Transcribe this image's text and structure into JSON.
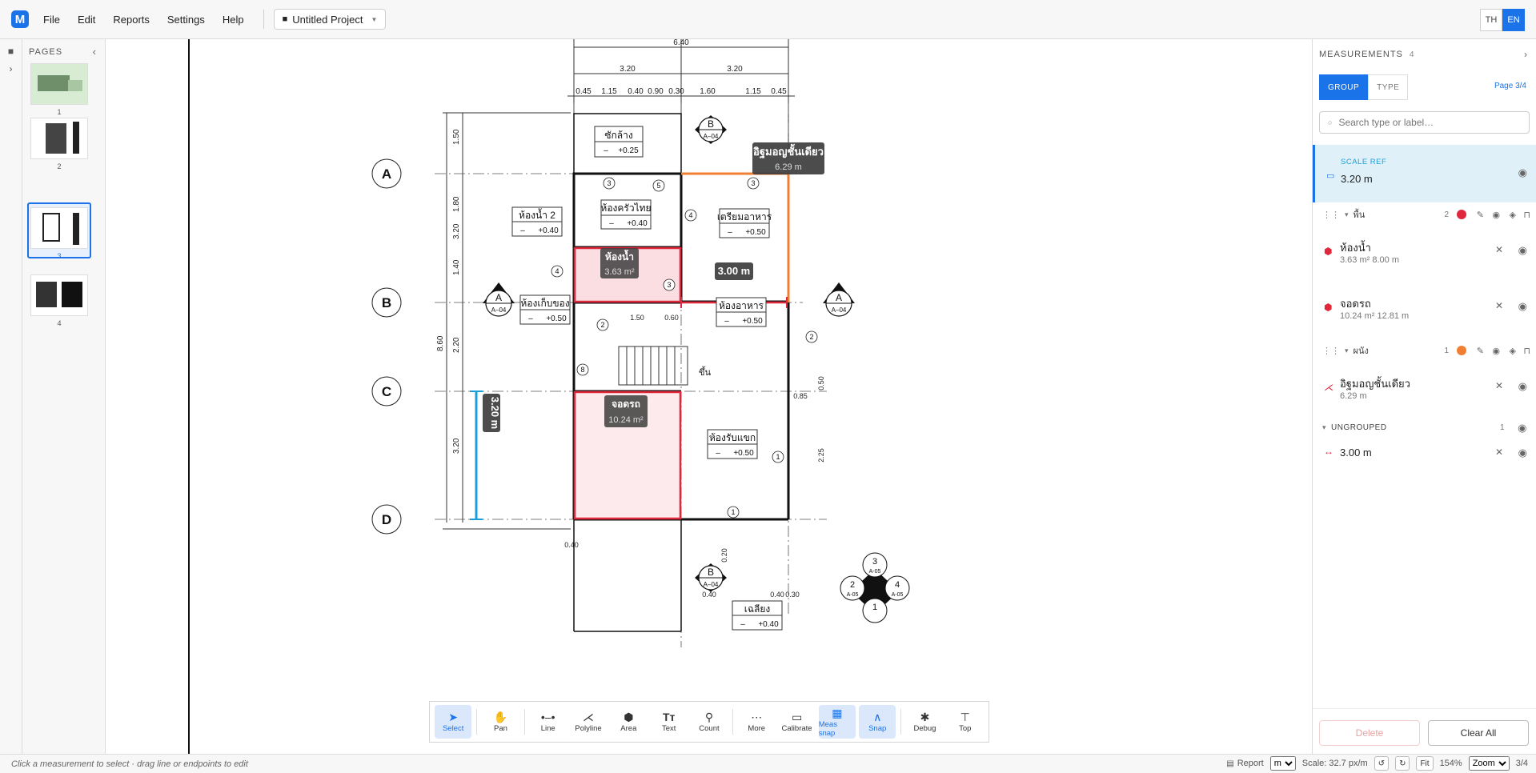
{
  "menu": {
    "file": "File",
    "edit": "Edit",
    "reports": "Reports",
    "settings": "Settings",
    "help": "Help"
  },
  "project": {
    "name": "Untitled Project"
  },
  "lang": {
    "th": "TH",
    "en": "EN"
  },
  "pages": {
    "title": "PAGES",
    "items": [
      {
        "num": "1"
      },
      {
        "num": "2"
      },
      {
        "num": "3"
      },
      {
        "num": "4"
      }
    ]
  },
  "plan": {
    "grid": [
      "A",
      "B",
      "C",
      "D"
    ],
    "dims_top": [
      "6.40",
      "3.20",
      "3.20",
      "0.45",
      "1.15",
      "0.40",
      "0.90",
      "0.30",
      "1.60",
      "1.15",
      "0.45"
    ],
    "dims_left": [
      "1.50",
      "1.80",
      "3.20",
      "1.40",
      "8.60",
      "2.20",
      "3.20"
    ],
    "rooms": [
      {
        "name": "ซักล้าง",
        "level": "+0.25"
      },
      {
        "name": "ห้องครัวไทย",
        "level": "+0.40"
      },
      {
        "name": "ห้องน้ำ 2",
        "level": "+0.40"
      },
      {
        "name": "เตรียมอาหาร",
        "level": "+0.50"
      },
      {
        "name": "ห้องเก็บของ",
        "level": "+0.50"
      },
      {
        "name": "ห้องอาหาร",
        "level": "+0.50"
      },
      {
        "name": "ห้องรับแขก",
        "level": "+0.50"
      },
      {
        "name": "เฉลียง",
        "level": "+0.40"
      }
    ],
    "dash": "–",
    "stairs_label": "ขึ้น",
    "labels": {
      "perimeter": {
        "name": "อิฐมอญชั้นเดียว",
        "value": "6.29 m"
      },
      "bath": {
        "name": "ห้องน้ำ",
        "value": "3.63 m²"
      },
      "garage": {
        "name": "จอดรถ",
        "value": "10.24 m²"
      },
      "line": "3.00 m",
      "scale": "3.20 m"
    },
    "section_marks": [
      {
        "letter": "B",
        "ref": "A–04"
      },
      {
        "letter": "A",
        "ref": "A–04"
      },
      {
        "letter": "A",
        "ref": "A–04"
      },
      {
        "letter": "B",
        "ref": "A–04"
      }
    ],
    "elev_marks": [
      {
        "num": "3",
        "ref": "A-05"
      },
      {
        "num": "2",
        "ref": "A-05"
      },
      {
        "num": "4",
        "ref": "A-05"
      },
      {
        "num": "1",
        "ref": ""
      }
    ],
    "small_dims": [
      "1.50",
      "0.60",
      "0.85",
      "0.50",
      "2.25",
      "0.40",
      "0.20",
      "0.40",
      "0.30",
      "0.40"
    ],
    "circles": [
      "3",
      "5",
      "3",
      "4",
      "4",
      "3",
      "2",
      "8",
      "2",
      "1",
      "1"
    ]
  },
  "toolbar": {
    "tools": [
      {
        "label": "Select"
      },
      {
        "label": "Pan"
      },
      {
        "label": "Line"
      },
      {
        "label": "Polyline"
      },
      {
        "label": "Area"
      },
      {
        "label": "Text"
      },
      {
        "label": "Count"
      },
      {
        "label": "More"
      },
      {
        "label": "Calibrate"
      },
      {
        "label": "Meas snap"
      },
      {
        "label": "Snap"
      },
      {
        "label": "Debug"
      },
      {
        "label": "Top"
      }
    ],
    "text_glyph": "Tт"
  },
  "measurements": {
    "title": "MEASUREMENTS",
    "count": "4",
    "tabs": {
      "group": "GROUP",
      "type": "TYPE"
    },
    "page_badge": "Page 3/4",
    "search_placeholder": "Search type or label…",
    "scale_ref": {
      "label": "SCALE REF",
      "value": "3.20 m"
    },
    "groups": [
      {
        "name": "พื้น",
        "count": "2",
        "color": "#e0283c"
      },
      {
        "name": "ผนัง",
        "count": "1",
        "color": "#f07f34"
      }
    ],
    "items": [
      {
        "name": "ห้องน้ำ",
        "sub": "3.63 m² 8.00 m"
      },
      {
        "name": "จอดรถ",
        "sub": "10.24 m² 12.81 m"
      },
      {
        "name": "อิฐมอญชั้นเดียว",
        "sub": "6.29 m"
      }
    ],
    "ungrouped": {
      "label": "UNGROUPED",
      "count": "1"
    },
    "ungrouped_item": {
      "value": "3.00 m"
    },
    "delete": "Delete",
    "clear_all": "Clear All"
  },
  "status": {
    "hint": "Click a measurement to select · drag line or endpoints to edit",
    "report": "Report",
    "unit": "m",
    "scale": "Scale: 32.7 px/m",
    "fit": "Fit",
    "zoom_pct": "154%",
    "zoom_select": "Zoom",
    "page": "3/4"
  },
  "colors": {
    "accent": "#1a73e8",
    "area": "#e0283c",
    "wall": "#f07f34",
    "scale": "#1a9fd8"
  }
}
